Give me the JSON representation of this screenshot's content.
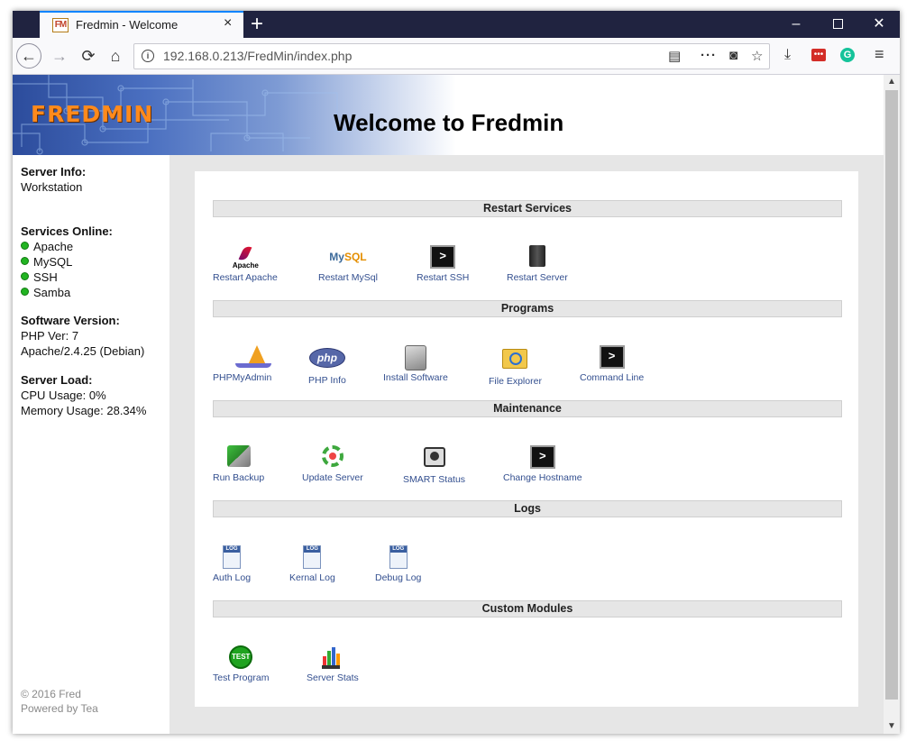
{
  "browser": {
    "tab_title": "Fredmin - Welcome",
    "tab_favicon_text": "FM",
    "close_tab_glyph": "×",
    "new_tab_glyph": "+",
    "url": "192.168.0.213/FredMin/index.php",
    "window_controls": {
      "minimize": "–",
      "maximize": "",
      "close": "✕"
    },
    "nav": {
      "back": "←",
      "forward": "→",
      "reload": "⟳",
      "home": "⌂"
    },
    "toolbar_icons": [
      "reader-view-icon",
      "page-actions-icon",
      "pocket-icon",
      "bookmark-star-icon",
      "download-icon",
      "lastpass-icon",
      "grammarly-icon",
      "menu-icon"
    ],
    "toolbar_glyphs": {
      "reader": "▤",
      "more": "···",
      "pocket": "◙",
      "star": "☆",
      "download": "⤓",
      "lastpass": "•••",
      "grammarly": "G",
      "menu": "≡"
    },
    "scroll": {
      "up": "▲",
      "down": "▼"
    }
  },
  "header": {
    "logo_text": "FREDMIN",
    "title": "Welcome to Fredmin"
  },
  "sidebar": {
    "server_info_heading": "Server Info:",
    "server_info_value": "Workstation",
    "services_heading": "Services Online:",
    "services": [
      "Apache",
      "MySQL",
      "SSH",
      "Samba"
    ],
    "software_heading": "Software Version:",
    "php_version": "PHP Ver: 7",
    "apache_version": "Apache/2.4.25 (Debian)",
    "load_heading": "Server Load:",
    "cpu_usage": "CPU Usage: 0%",
    "memory_usage": "Memory Usage: 28.34%",
    "footer_copyright": "© 2016 Fred",
    "footer_powered": "Powered by Tea"
  },
  "sections": {
    "restart": {
      "title": "Restart Services",
      "items": [
        {
          "label": "Restart Apache",
          "icon": "apache-feather-icon"
        },
        {
          "label": "Restart MySql",
          "icon": "mysql-dolphin-icon"
        },
        {
          "label": "Restart SSH",
          "icon": "terminal-icon"
        },
        {
          "label": "Restart Server",
          "icon": "server-tower-icon"
        }
      ]
    },
    "programs": {
      "title": "Programs",
      "items": [
        {
          "label": "PHPMyAdmin",
          "icon": "phpmyadmin-sailboat-icon"
        },
        {
          "label": "PHP Info",
          "icon": "php-logo-icon"
        },
        {
          "label": "Install Software",
          "icon": "installer-icon"
        },
        {
          "label": "File Explorer",
          "icon": "folder-magnifier-icon"
        },
        {
          "label": "Command Line",
          "icon": "terminal-icon"
        }
      ]
    },
    "maintenance": {
      "title": "Maintenance",
      "items": [
        {
          "label": "Run Backup",
          "icon": "backup-drive-icon"
        },
        {
          "label": "Update Server",
          "icon": "update-gear-icon"
        },
        {
          "label": "SMART Status",
          "icon": "hard-disk-icon"
        },
        {
          "label": "Change Hostname",
          "icon": "terminal-icon"
        }
      ]
    },
    "logs": {
      "title": "Logs",
      "items": [
        {
          "label": "Auth Log",
          "icon": "log-file-icon"
        },
        {
          "label": "Kernal Log",
          "icon": "log-file-icon"
        },
        {
          "label": "Debug Log",
          "icon": "log-file-icon"
        }
      ]
    },
    "custom": {
      "title": "Custom Modules",
      "items": [
        {
          "label": "Test Program",
          "icon": "test-badge-icon"
        },
        {
          "label": "Server Stats",
          "icon": "bar-stats-icon"
        }
      ]
    }
  },
  "icon_text": {
    "apache": "Apache",
    "mysql_a": "My",
    "mysql_b": "SQL",
    "php": "php",
    "terminal": ">",
    "log": "LOG",
    "test": "TEST"
  },
  "colors": {
    "link": "#334f8f",
    "section_bar": "#e6e6e6",
    "service_online": "#22b422",
    "logo_orange": "#ff8a1c"
  }
}
